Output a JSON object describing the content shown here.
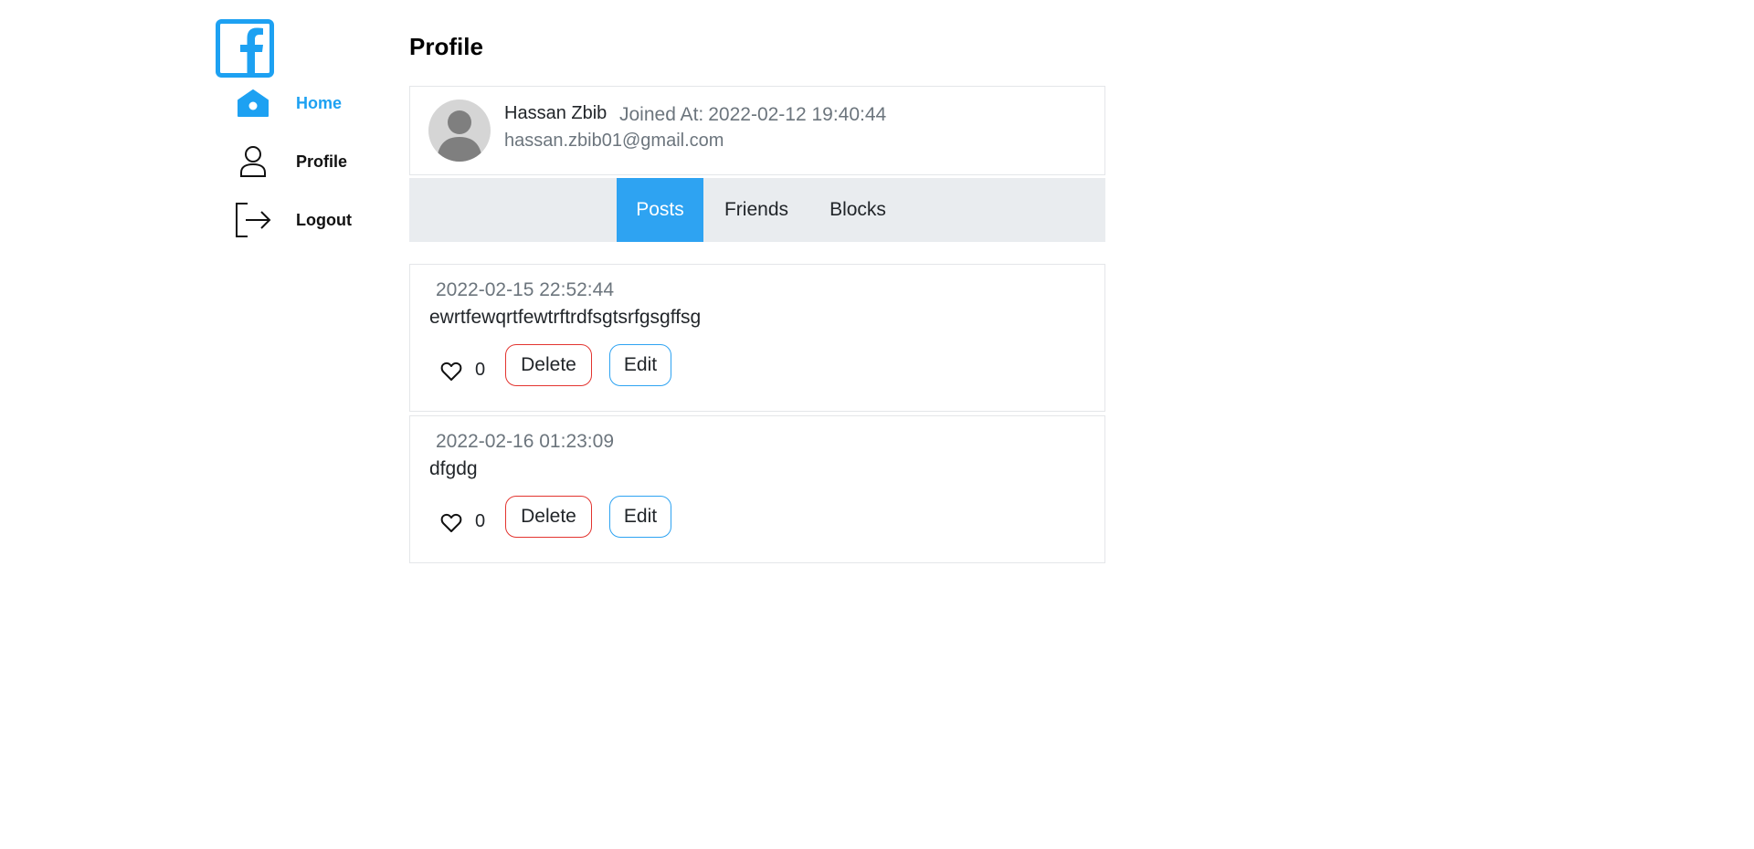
{
  "sidebar": {
    "logo": "facebook-logo",
    "items": [
      {
        "label": "Home",
        "icon": "home-icon",
        "active": true
      },
      {
        "label": "Profile",
        "icon": "user-icon",
        "active": false
      },
      {
        "label": "Logout",
        "icon": "logout-icon",
        "active": false
      }
    ]
  },
  "page": {
    "title": "Profile"
  },
  "profile": {
    "name": "Hassan Zbib",
    "joined_label": "Joined At:",
    "joined_date": "2022-02-12 19:40:44",
    "email": "hassan.zbib01@gmail.com"
  },
  "tabs": [
    {
      "label": "Posts",
      "active": true
    },
    {
      "label": "Friends",
      "active": false
    },
    {
      "label": "Blocks",
      "active": false
    }
  ],
  "posts": [
    {
      "date": "2022-02-15 22:52:44",
      "text": "ewrtfewqrtfewtrftrdfsgtsrfgsgffsg",
      "likes": "0",
      "delete_label": "Delete",
      "edit_label": "Edit"
    },
    {
      "date": "2022-02-16 01:23:09",
      "text": "dfgdg",
      "likes": "0",
      "delete_label": "Delete",
      "edit_label": "Edit"
    }
  ],
  "colors": {
    "accent": "#1da1f2",
    "danger": "#e3342f",
    "tab_bg": "#e9ecef",
    "muted": "#6c757d"
  }
}
